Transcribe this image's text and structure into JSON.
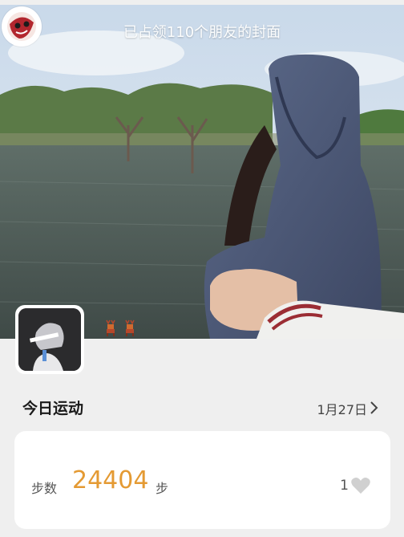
{
  "cover": {
    "caption": "已占领110个朋友的封面"
  },
  "icons": {
    "corner_avatar": "red-mask-avatar",
    "user_avatar": "profile-avatar",
    "likers": [
      "deer-sprite-icon",
      "deer-sprite-icon"
    ],
    "chevron": "chevron-right-icon",
    "heart": "heart-icon"
  },
  "section": {
    "title": "今日运动",
    "date": "1月27日"
  },
  "steps_card": {
    "label": "步数",
    "value": "24404",
    "unit": "步",
    "like_count": "1"
  },
  "colors": {
    "accent": "#e49a33",
    "background": "#efefef",
    "card": "#ffffff"
  }
}
